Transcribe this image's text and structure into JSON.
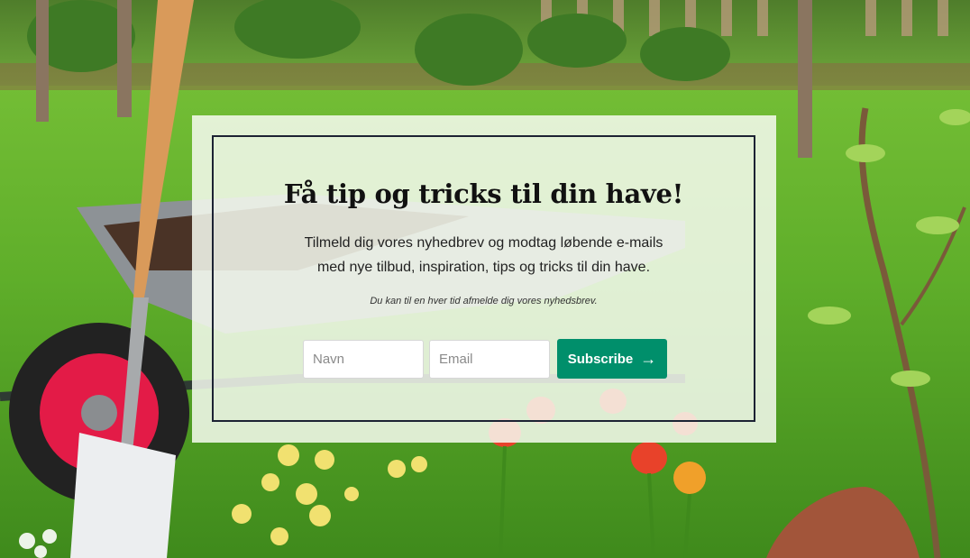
{
  "newsletter": {
    "title": "Få tip og tricks til din have!",
    "description_line1": "Tilmeld dig vores nyhedbrev og modtag løbende e-mails",
    "description_line2": "med nye tilbud, inspiration, tips og tricks til din have.",
    "unsubscribe_note": "Du kan til en hver tid afmelde dig vores nyhedsbrev.",
    "name_placeholder": "Navn",
    "email_placeholder": "Email",
    "subscribe_label": "Subscribe",
    "subscribe_icon": "arrow-right-icon"
  },
  "colors": {
    "button": "#008f6b",
    "frame_border": "#1c2233",
    "card_background": "#f6faf0"
  }
}
